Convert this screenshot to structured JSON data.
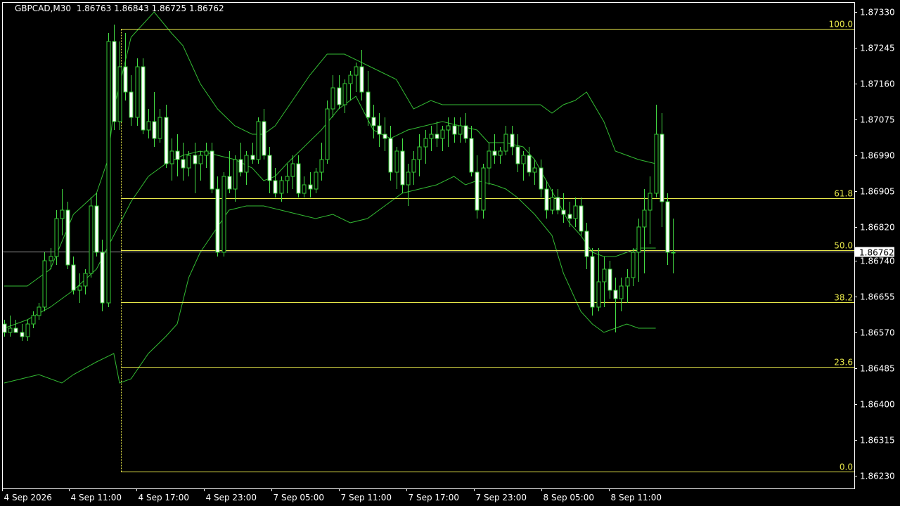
{
  "header": {
    "symbol": "GBPCAD,M30",
    "ohlc": "1.86763 1.86843 1.86725 1.86762"
  },
  "price_label": "1.86762",
  "colors": {
    "background": "#000000",
    "axis": "#ffffff",
    "candle_up_fill": "#000000",
    "candle_down_fill": "#ffffff",
    "candle_outline": "#33cc33",
    "wick": "#44dd44",
    "band": "#33bb33",
    "fibo": "#e8e84a",
    "bid_line": "#999999",
    "price_label_bg": "#ffffff",
    "price_label_text": "#000000"
  },
  "chart_data": {
    "type": "candlestick",
    "title": "GBPCAD,M30",
    "ylim": [
      1.8619,
      1.8738
    ],
    "y_ticks": [
      "1.87330",
      "1.87245",
      "1.87160",
      "1.87075",
      "1.86990",
      "1.86905",
      "1.86820",
      "1.86740",
      "1.86655",
      "1.86570",
      "1.86485",
      "1.86400",
      "1.86315",
      "1.86230"
    ],
    "x_ticks": [
      "4 Sep 2026",
      "4 Sep 11:00",
      "4 Sep 17:00",
      "4 Sep 23:00",
      "7 Sep 05:00",
      "7 Sep 11:00",
      "7 Sep 17:00",
      "7 Sep 23:00",
      "8 Sep 05:00",
      "8 Sep 11:00"
    ],
    "bid": 1.86762,
    "fibonacci": {
      "level_100_price": 1.8729,
      "level_0_price": 1.8624,
      "levels": [
        {
          "label": "100.0",
          "ratio": 1.0
        },
        {
          "label": "61.8",
          "ratio": 0.618
        },
        {
          "label": "50.0",
          "ratio": 0.5
        },
        {
          "label": "38.2",
          "ratio": 0.382
        },
        {
          "label": "23.6",
          "ratio": 0.236
        },
        {
          "label": "0.0",
          "ratio": 0.0
        }
      ]
    },
    "candles": [
      [
        1.8659,
        1.866,
        1.8656,
        1.8657
      ],
      [
        1.8657,
        1.8661,
        1.8656,
        1.8658
      ],
      [
        1.8658,
        1.866,
        1.8657,
        1.8657
      ],
      [
        1.8657,
        1.8659,
        1.8655,
        1.8656
      ],
      [
        1.8656,
        1.866,
        1.8655,
        1.8659
      ],
      [
        1.8659,
        1.8662,
        1.8658,
        1.8661
      ],
      [
        1.8661,
        1.8664,
        1.866,
        1.8663
      ],
      [
        1.8663,
        1.8676,
        1.8662,
        1.8674
      ],
      [
        1.8674,
        1.8677,
        1.8672,
        1.8675
      ],
      [
        1.8675,
        1.8686,
        1.8673,
        1.8684
      ],
      [
        1.8684,
        1.8691,
        1.868,
        1.8686
      ],
      [
        1.8686,
        1.8688,
        1.8672,
        1.8673
      ],
      [
        1.8673,
        1.8675,
        1.8666,
        1.8667
      ],
      [
        1.8667,
        1.8671,
        1.8664,
        1.8668
      ],
      [
        1.8668,
        1.8672,
        1.8666,
        1.8671
      ],
      [
        1.8671,
        1.8689,
        1.867,
        1.8687
      ],
      [
        1.8687,
        1.869,
        1.8675,
        1.8676
      ],
      [
        1.8676,
        1.8679,
        1.8662,
        1.8664
      ],
      [
        1.8664,
        1.8728,
        1.8663,
        1.8726
      ],
      [
        1.8726,
        1.873,
        1.8705,
        1.8707
      ],
      [
        1.8707,
        1.8726,
        1.8705,
        1.872
      ],
      [
        1.872,
        1.8728,
        1.8712,
        1.8714
      ],
      [
        1.8714,
        1.8718,
        1.8706,
        1.8708
      ],
      [
        1.8708,
        1.8722,
        1.8706,
        1.872
      ],
      [
        1.872,
        1.8722,
        1.8704,
        1.8705
      ],
      [
        1.8705,
        1.871,
        1.8703,
        1.8707
      ],
      [
        1.8707,
        1.8714,
        1.8701,
        1.8703
      ],
      [
        1.8703,
        1.871,
        1.8702,
        1.8708
      ],
      [
        1.8708,
        1.8711,
        1.8696,
        1.8697
      ],
      [
        1.8697,
        1.8703,
        1.8693,
        1.87
      ],
      [
        1.87,
        1.8704,
        1.8694,
        1.8698
      ],
      [
        1.8698,
        1.8702,
        1.8693,
        1.8696
      ],
      [
        1.8696,
        1.87,
        1.8694,
        1.8699
      ],
      [
        1.8699,
        1.8702,
        1.869,
        1.8697
      ],
      [
        1.8697,
        1.87,
        1.8693,
        1.8699
      ],
      [
        1.8699,
        1.8702,
        1.8696,
        1.87
      ],
      [
        1.87,
        1.8702,
        1.869,
        1.8691
      ],
      [
        1.8691,
        1.8694,
        1.8675,
        1.8676
      ],
      [
        1.8676,
        1.8695,
        1.8675,
        1.8694
      ],
      [
        1.8694,
        1.87,
        1.869,
        1.8691
      ],
      [
        1.8691,
        1.8699,
        1.8688,
        1.8698
      ],
      [
        1.8698,
        1.8702,
        1.8694,
        1.8695
      ],
      [
        1.8695,
        1.87,
        1.8692,
        1.8699
      ],
      [
        1.8699,
        1.8702,
        1.8697,
        1.8698
      ],
      [
        1.8698,
        1.8708,
        1.8697,
        1.8707
      ],
      [
        1.8707,
        1.871,
        1.8698,
        1.8699
      ],
      [
        1.8699,
        1.8701,
        1.869,
        1.8693
      ],
      [
        1.8693,
        1.8696,
        1.8689,
        1.869
      ],
      [
        1.869,
        1.8694,
        1.8688,
        1.8693
      ],
      [
        1.8693,
        1.8697,
        1.869,
        1.8694
      ],
      [
        1.8694,
        1.8699,
        1.8691,
        1.8697
      ],
      [
        1.8697,
        1.8699,
        1.8689,
        1.869
      ],
      [
        1.869,
        1.8694,
        1.8689,
        1.8692
      ],
      [
        1.8692,
        1.8695,
        1.8689,
        1.8691
      ],
      [
        1.8691,
        1.8696,
        1.869,
        1.8695
      ],
      [
        1.8695,
        1.8702,
        1.8693,
        1.8698
      ],
      [
        1.8698,
        1.8712,
        1.8697,
        1.871
      ],
      [
        1.871,
        1.8718,
        1.8708,
        1.8715
      ],
      [
        1.8715,
        1.8718,
        1.871,
        1.8711
      ],
      [
        1.8711,
        1.8717,
        1.8709,
        1.8716
      ],
      [
        1.8716,
        1.8719,
        1.8712,
        1.8718
      ],
      [
        1.8718,
        1.8721,
        1.8714,
        1.872
      ],
      [
        1.872,
        1.8724,
        1.8712,
        1.8714
      ],
      [
        1.8714,
        1.8719,
        1.8706,
        1.8708
      ],
      [
        1.8708,
        1.8711,
        1.8703,
        1.8706
      ],
      [
        1.8706,
        1.8709,
        1.8701,
        1.8704
      ],
      [
        1.8704,
        1.8708,
        1.87,
        1.8703
      ],
      [
        1.8703,
        1.8706,
        1.8693,
        1.8695
      ],
      [
        1.8695,
        1.8701,
        1.8691,
        1.87
      ],
      [
        1.87,
        1.8703,
        1.869,
        1.8692
      ],
      [
        1.8692,
        1.8697,
        1.8687,
        1.8695
      ],
      [
        1.8695,
        1.87,
        1.8692,
        1.8698
      ],
      [
        1.8698,
        1.8704,
        1.8694,
        1.8701
      ],
      [
        1.8701,
        1.8705,
        1.8697,
        1.8703
      ],
      [
        1.8703,
        1.8706,
        1.87,
        1.8704
      ],
      [
        1.8704,
        1.8707,
        1.8701,
        1.8703
      ],
      [
        1.8703,
        1.8706,
        1.87,
        1.8705
      ],
      [
        1.8705,
        1.8708,
        1.8701,
        1.8706
      ],
      [
        1.8706,
        1.8708,
        1.8702,
        1.8704
      ],
      [
        1.8704,
        1.8708,
        1.8702,
        1.8706
      ],
      [
        1.8706,
        1.8709,
        1.8702,
        1.8703
      ],
      [
        1.8703,
        1.8706,
        1.8694,
        1.8695
      ],
      [
        1.8695,
        1.8699,
        1.8684,
        1.8686
      ],
      [
        1.8686,
        1.8697,
        1.8684,
        1.8696
      ],
      [
        1.8696,
        1.8702,
        1.8692,
        1.87
      ],
      [
        1.87,
        1.8704,
        1.8697,
        1.8699
      ],
      [
        1.8699,
        1.8701,
        1.8697,
        1.87
      ],
      [
        1.87,
        1.8706,
        1.8699,
        1.8704
      ],
      [
        1.8704,
        1.8706,
        1.8699,
        1.8701
      ],
      [
        1.8701,
        1.8704,
        1.8695,
        1.8697
      ],
      [
        1.8697,
        1.87,
        1.8693,
        1.8699
      ],
      [
        1.8699,
        1.8701,
        1.8694,
        1.8695
      ],
      [
        1.8695,
        1.8698,
        1.8692,
        1.8696
      ],
      [
        1.8696,
        1.8698,
        1.8689,
        1.8691
      ],
      [
        1.8691,
        1.8693,
        1.8684,
        1.8686
      ],
      [
        1.8686,
        1.8691,
        1.8685,
        1.8689
      ],
      [
        1.8689,
        1.8691,
        1.8685,
        1.8686
      ],
      [
        1.8686,
        1.869,
        1.8683,
        1.8685
      ],
      [
        1.8685,
        1.8688,
        1.8682,
        1.8684
      ],
      [
        1.8684,
        1.8689,
        1.8682,
        1.8687
      ],
      [
        1.8687,
        1.8689,
        1.868,
        1.8681
      ],
      [
        1.8681,
        1.8683,
        1.8672,
        1.8675
      ],
      [
        1.8675,
        1.8677,
        1.8661,
        1.8663
      ],
      [
        1.8663,
        1.8677,
        1.8662,
        1.8669
      ],
      [
        1.8669,
        1.8675,
        1.8663,
        1.8672
      ],
      [
        1.8672,
        1.8674,
        1.8665,
        1.8667
      ],
      [
        1.8667,
        1.867,
        1.8657,
        1.8665
      ],
      [
        1.8665,
        1.867,
        1.8662,
        1.8668
      ],
      [
        1.8668,
        1.8672,
        1.8664,
        1.867
      ],
      [
        1.867,
        1.8677,
        1.8668,
        1.8676
      ],
      [
        1.8676,
        1.8684,
        1.8669,
        1.8682
      ],
      [
        1.8682,
        1.8691,
        1.8671,
        1.8686
      ],
      [
        1.8686,
        1.8694,
        1.8678,
        1.869
      ],
      [
        1.869,
        1.8711,
        1.8689,
        1.8704
      ],
      [
        1.8704,
        1.8709,
        1.8682,
        1.8688
      ],
      [
        1.8688,
        1.869,
        1.8673,
        1.8676
      ],
      [
        1.8676,
        1.8684,
        1.8671,
        1.8676
      ]
    ],
    "bollinger_upper": [
      [
        0,
        1.8668
      ],
      [
        4,
        1.8668
      ],
      [
        8,
        1.8672
      ],
      [
        12,
        1.8685
      ],
      [
        16,
        1.869
      ],
      [
        18,
        1.8698
      ],
      [
        19,
        1.871
      ],
      [
        22,
        1.8727
      ],
      [
        26,
        1.8733
      ],
      [
        29,
        1.8728
      ],
      [
        31,
        1.8725
      ],
      [
        34,
        1.8716
      ],
      [
        37,
        1.871
      ],
      [
        40,
        1.8706
      ],
      [
        43,
        1.8704
      ],
      [
        45,
        1.8704
      ],
      [
        47,
        1.8706
      ],
      [
        50,
        1.8712
      ],
      [
        53,
        1.8718
      ],
      [
        56,
        1.8723
      ],
      [
        59,
        1.8723
      ],
      [
        62,
        1.8721
      ],
      [
        65,
        1.8719
      ],
      [
        68,
        1.8717
      ],
      [
        71,
        1.871
      ],
      [
        74,
        1.8712
      ],
      [
        76,
        1.8711
      ],
      [
        79,
        1.8711
      ],
      [
        82,
        1.8711
      ],
      [
        85,
        1.8711
      ],
      [
        88,
        1.8711
      ],
      [
        91,
        1.8711
      ],
      [
        93,
        1.8711
      ],
      [
        95,
        1.8709
      ],
      [
        97,
        1.8711
      ],
      [
        99,
        1.8712
      ],
      [
        101,
        1.8714
      ],
      [
        104,
        1.8707
      ],
      [
        106,
        1.87
      ],
      [
        108,
        1.8699
      ],
      [
        110,
        1.8698
      ],
      [
        113,
        1.8697
      ]
    ],
    "bollinger_middle": [
      [
        0,
        1.8658
      ],
      [
        4,
        1.866
      ],
      [
        8,
        1.8663
      ],
      [
        12,
        1.8667
      ],
      [
        16,
        1.8672
      ],
      [
        19,
        1.868
      ],
      [
        22,
        1.8688
      ],
      [
        25,
        1.8694
      ],
      [
        28,
        1.8697
      ],
      [
        31,
        1.8699
      ],
      [
        34,
        1.87
      ],
      [
        37,
        1.8699
      ],
      [
        40,
        1.8698
      ],
      [
        43,
        1.8696
      ],
      [
        45,
        1.8693
      ],
      [
        47,
        1.8694
      ],
      [
        49,
        1.8697
      ],
      [
        52,
        1.8701
      ],
      [
        55,
        1.8705
      ],
      [
        58,
        1.871
      ],
      [
        61,
        1.8713
      ],
      [
        64,
        1.8705
      ],
      [
        67,
        1.8703
      ],
      [
        70,
        1.8705
      ],
      [
        73,
        1.8706
      ],
      [
        76,
        1.8707
      ],
      [
        79,
        1.8706
      ],
      [
        82,
        1.8705
      ],
      [
        84,
        1.8702
      ],
      [
        87,
        1.8702
      ],
      [
        90,
        1.8701
      ],
      [
        92,
        1.8698
      ],
      [
        94,
        1.8693
      ],
      [
        96,
        1.8688
      ],
      [
        98,
        1.8683
      ],
      [
        100,
        1.868
      ],
      [
        102,
        1.8676
      ],
      [
        104,
        1.8675
      ],
      [
        106,
        1.8675
      ],
      [
        108,
        1.8676
      ],
      [
        110,
        1.8677
      ],
      [
        113,
        1.8677
      ]
    ],
    "bollinger_lower": [
      [
        0,
        1.8645
      ],
      [
        3,
        1.8646
      ],
      [
        6,
        1.8647
      ],
      [
        10,
        1.8645
      ],
      [
        12,
        1.8647
      ],
      [
        16,
        1.865
      ],
      [
        19,
        1.8652
      ],
      [
        20,
        1.8645
      ],
      [
        22,
        1.8646
      ],
      [
        25,
        1.8652
      ],
      [
        28,
        1.8656
      ],
      [
        30,
        1.8659
      ],
      [
        32,
        1.867
      ],
      [
        34,
        1.8676
      ],
      [
        36,
        1.868
      ],
      [
        39,
        1.8686
      ],
      [
        42,
        1.8687
      ],
      [
        45,
        1.8687
      ],
      [
        48,
        1.8686
      ],
      [
        51,
        1.8685
      ],
      [
        54,
        1.8684
      ],
      [
        57,
        1.8685
      ],
      [
        60,
        1.8683
      ],
      [
        63,
        1.8684
      ],
      [
        66,
        1.8687
      ],
      [
        69,
        1.869
      ],
      [
        72,
        1.8691
      ],
      [
        75,
        1.8692
      ],
      [
        78,
        1.8694
      ],
      [
        80,
        1.8692
      ],
      [
        82,
        1.8693
      ],
      [
        85,
        1.8692
      ],
      [
        87,
        1.8691
      ],
      [
        89,
        1.8689
      ],
      [
        92,
        1.8685
      ],
      [
        95,
        1.868
      ],
      [
        97,
        1.8671
      ],
      [
        100,
        1.8662
      ],
      [
        102,
        1.8659
      ],
      [
        104,
        1.8657
      ],
      [
        106,
        1.8658
      ],
      [
        108,
        1.8659
      ],
      [
        110,
        1.8658
      ],
      [
        113,
        1.8658
      ]
    ]
  }
}
